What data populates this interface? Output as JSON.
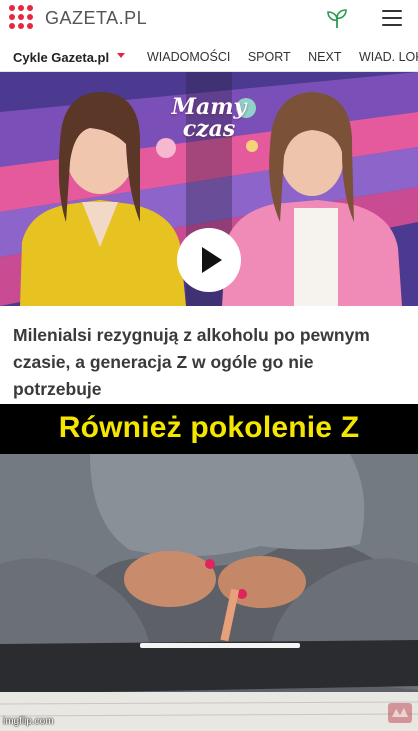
{
  "header": {
    "site_name": "GAZETA.PL",
    "brand_color": "#e5283f",
    "icons": [
      "logo-dots-icon",
      "leaf-icon",
      "menu-icon"
    ]
  },
  "nav": {
    "brand": "Cykle Gazeta.pl",
    "items": [
      "WIADOMOŚCI",
      "SPORT",
      "NEXT",
      "WIAD. LOKAL"
    ]
  },
  "video": {
    "show_logo": "Mamy czas",
    "play_icon": "play-icon"
  },
  "article": {
    "headline": "Milenialsi rezygnują z alkoholu po pewnym czasie, a generacja Z w ogóle go nie potrzebuje"
  },
  "meme": {
    "caption": "Również pokolenie Z",
    "caption_color": "#f5e600",
    "watermark": "imgflip.com"
  }
}
